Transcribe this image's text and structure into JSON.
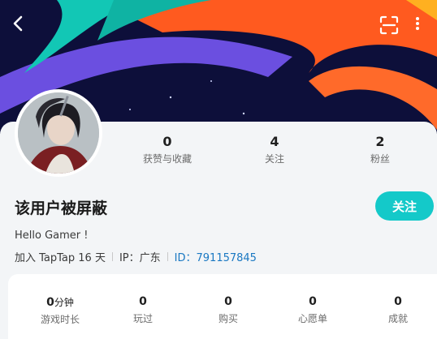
{
  "header": {
    "back_icon": "back-chevron-icon",
    "scan_icon": "scan-icon",
    "more_icon": "more-vertical-icon",
    "banner_colors": [
      "#0d0f3a",
      "#ff5a1f",
      "#12c7b5",
      "#6b4fe0",
      "#ffb020"
    ]
  },
  "profile": {
    "username": "该用户被屏蔽",
    "bio": "Hello Gamer !",
    "joined": "加入 TapTap 16 天",
    "ip_label": "IP：广东",
    "id_label": "ID：",
    "id_value": "791157845",
    "follow_label": "关注",
    "accent_color": "#14c9c9"
  },
  "stats": [
    {
      "value": "0",
      "label": "获赞与收藏"
    },
    {
      "value": "4",
      "label": "关注"
    },
    {
      "value": "2",
      "label": "粉丝"
    }
  ],
  "game_stats": {
    "playtime_value": "0",
    "playtime_unit": "分钟",
    "playtime_label": "游戏时长",
    "played_value": "0",
    "played_label": "玩过",
    "bought_value": "0",
    "bought_label": "购买",
    "wishlist_value": "0",
    "wishlist_label": "心愿单",
    "achievements_value": "0",
    "achievements_label": "成就"
  }
}
